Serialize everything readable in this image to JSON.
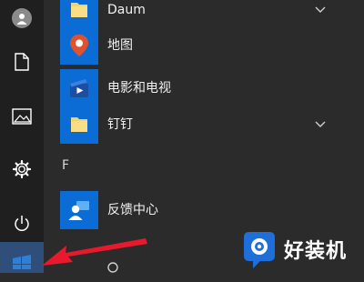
{
  "rail": {
    "icons": [
      "avatar-icon",
      "document-icon",
      "pictures-icon",
      "settings-gear-icon",
      "power-icon"
    ]
  },
  "apps": [
    {
      "label": "Daum",
      "icon": "folder-icon",
      "tile_color": "#0b6cd6",
      "expandable": true
    },
    {
      "label": "地图",
      "icon": "map-pin-icon",
      "tile_color": "#0b6cd6",
      "expandable": false
    },
    {
      "label": "电影和电视",
      "icon": "movies-tv-icon",
      "tile_color": "#0b6cd6",
      "expandable": false
    },
    {
      "label": "钉钉",
      "icon": "folder-icon",
      "tile_color": "#0b6cd6",
      "expandable": true
    }
  ],
  "section_letter": "F",
  "apps_f": [
    {
      "label": "反馈中心",
      "icon": "feedback-hub-icon",
      "tile_color": "#0b6cd6",
      "expandable": false
    }
  ],
  "watermark": {
    "text": "好装机",
    "icon": "watermark-logo-icon"
  },
  "colors": {
    "accent": "#0b6cd6",
    "start_button": "#2f4f7a",
    "annotation_arrow": "#e8192c"
  }
}
